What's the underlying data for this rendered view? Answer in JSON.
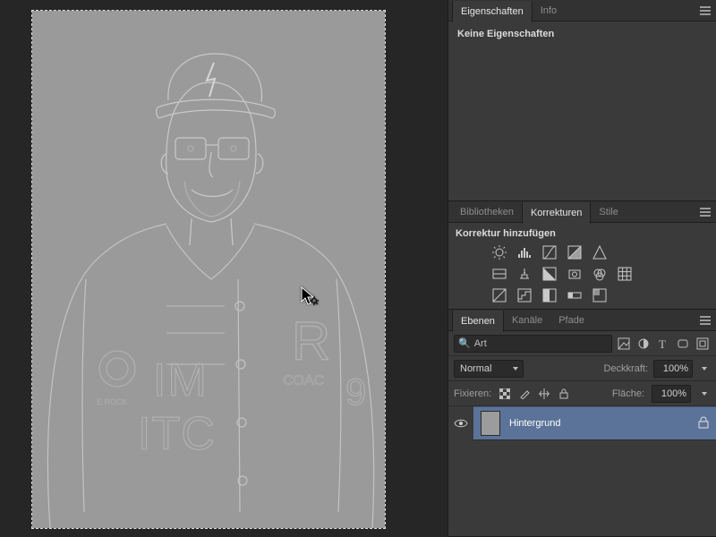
{
  "panels": {
    "properties": {
      "tabs": {
        "properties": "Eigenschaften",
        "info": "Info"
      },
      "body": "Keine Eigenschaften"
    },
    "libraries": {
      "tabs": {
        "libraries": "Bibliotheken",
        "adjustments": "Korrekturen",
        "styles": "Stile"
      },
      "add_label": "Korrektur hinzufügen"
    },
    "layers": {
      "tabs": {
        "layers": "Ebenen",
        "channels": "Kanäle",
        "paths": "Pfade"
      },
      "search_placeholder": "Art",
      "blend_mode": "Normal",
      "opacity_label": "Deckkraft:",
      "opacity_value": "100%",
      "lock_label": "Fixieren:",
      "fill_label": "Fläche:",
      "fill_value": "100%",
      "rows": [
        {
          "name": "Hintergrund",
          "locked": true
        }
      ]
    }
  }
}
